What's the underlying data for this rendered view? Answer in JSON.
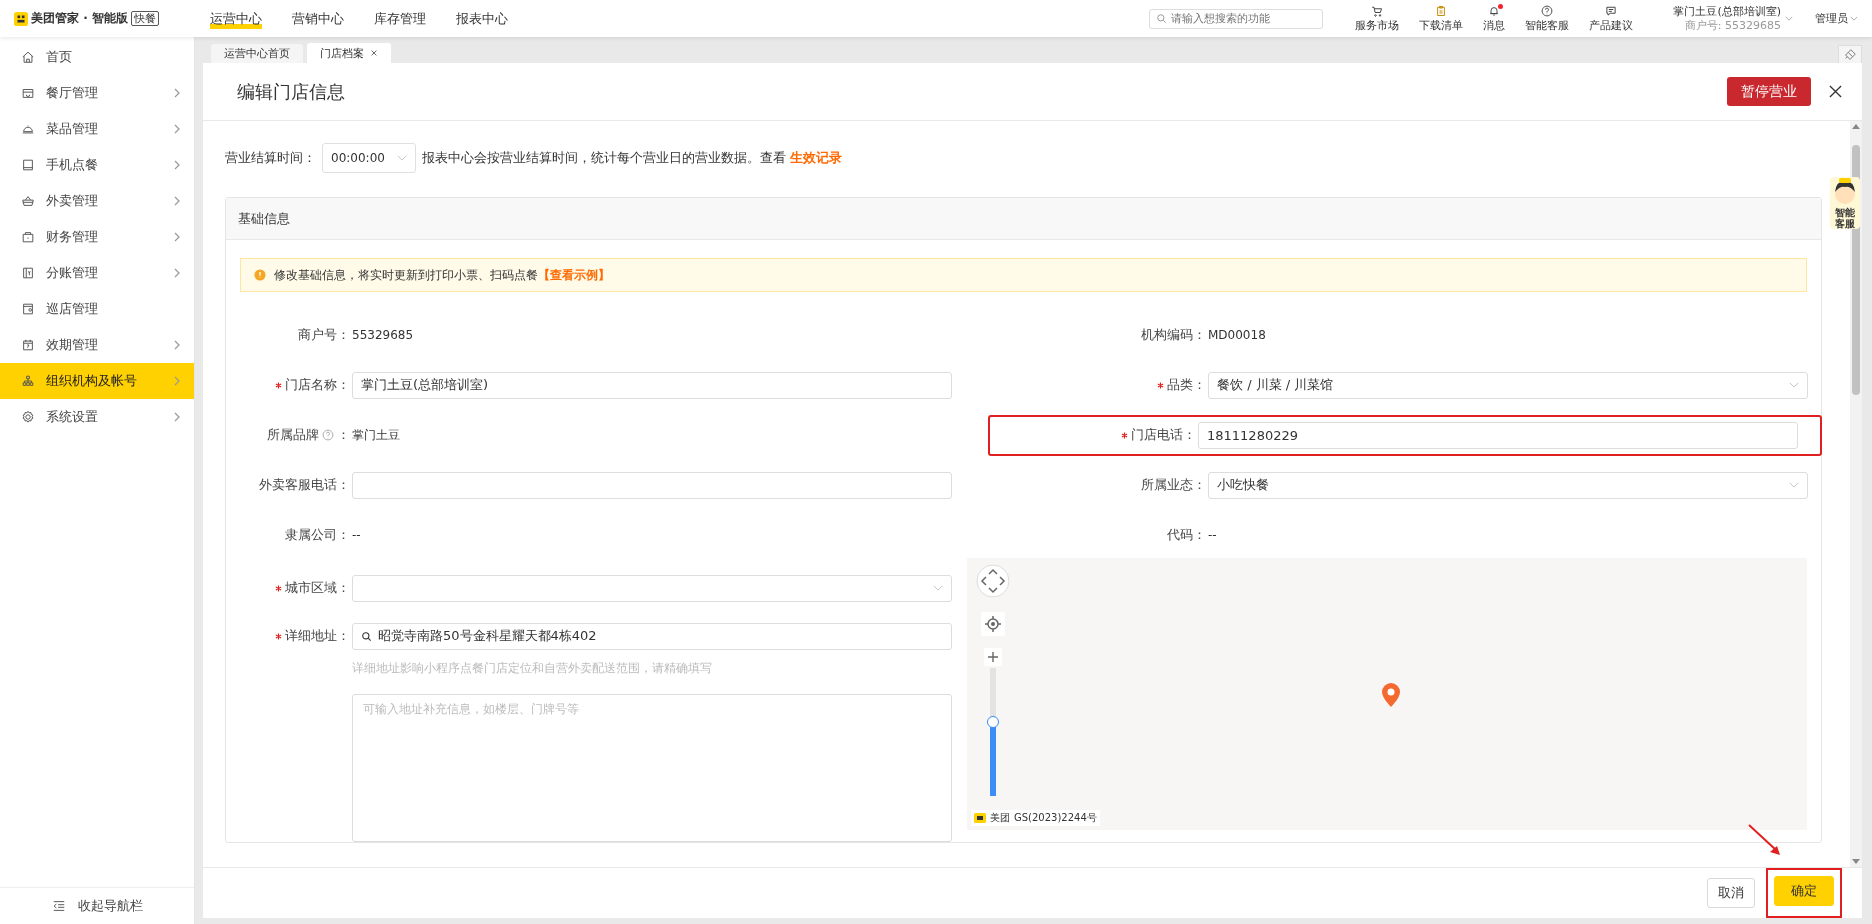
{
  "app": {
    "logo_text": "美团管家 · 智能版",
    "edition_badge": "快餐"
  },
  "top_nav": [
    {
      "label": "运营中心",
      "selected": true
    },
    {
      "label": "营销中心",
      "selected": false
    },
    {
      "label": "库存管理",
      "selected": false
    },
    {
      "label": "报表中心",
      "selected": false
    }
  ],
  "search": {
    "placeholder": "请输入想搜索的功能"
  },
  "toolbar": [
    {
      "label": "服务市场",
      "kind": "cart",
      "unread": false
    },
    {
      "label": "下载清单",
      "kind": "clipboard",
      "unread": false
    },
    {
      "label": "消息",
      "kind": "bell",
      "unread": true
    },
    {
      "label": "智能客服",
      "kind": "help",
      "unread": false
    },
    {
      "label": "产品建议",
      "kind": "chat",
      "unread": false
    }
  ],
  "account": {
    "store": "掌门土豆(总部培训室)",
    "merchant_id": "商户号: 55329685",
    "role": "管理员"
  },
  "sidebar": {
    "items": [
      {
        "label": "首页",
        "kind": "home",
        "has_submenu": false,
        "selected": false
      },
      {
        "label": "餐厅管理",
        "kind": "store",
        "has_submenu": true,
        "selected": false
      },
      {
        "label": "菜品管理",
        "kind": "cloche",
        "has_submenu": true,
        "selected": false
      },
      {
        "label": "手机点餐",
        "kind": "tablet",
        "has_submenu": true,
        "selected": false
      },
      {
        "label": "外卖管理",
        "kind": "basket",
        "has_submenu": true,
        "selected": false
      },
      {
        "label": "财务管理",
        "kind": "wallet",
        "has_submenu": true,
        "selected": false
      },
      {
        "label": "分账管理",
        "kind": "ledger",
        "has_submenu": true,
        "selected": false
      },
      {
        "label": "巡店管理",
        "kind": "patrol",
        "has_submenu": false,
        "selected": false
      },
      {
        "label": "效期管理",
        "kind": "calendar",
        "has_submenu": true,
        "selected": false
      },
      {
        "label": "组织机构及帐号",
        "kind": "org",
        "has_submenu": true,
        "selected": true
      },
      {
        "label": "系统设置",
        "kind": "gear",
        "has_submenu": true,
        "selected": false
      }
    ],
    "collapse_label": "收起导航栏"
  },
  "page_tabs": [
    {
      "label": "运营中心首页",
      "selected": false,
      "closable": false
    },
    {
      "label": "门店档案",
      "selected": true,
      "closable": true
    }
  ],
  "assistant_float": {
    "label": "智能客服"
  },
  "dialog": {
    "title": "编辑门店信息",
    "pause_button": "暂停营业",
    "settlement": {
      "label": "营业结算时间：",
      "value": "00:00:00",
      "note": "报表中心会按营业结算时间，统计每个营业日的营业数据。查看",
      "link": "生效记录"
    },
    "section_title": "基础信息",
    "alert": {
      "text": "修改基础信息，将实时更新到打印小票、扫码点餐",
      "link": "【查看示例】"
    },
    "fields": [
      {
        "kind": "text",
        "label": "商户号：",
        "value": "55329685",
        "required": false,
        "highlighted": false
      },
      {
        "kind": "text",
        "label": "机构编码：",
        "value": "MD00018",
        "required": false,
        "highlighted": false
      },
      {
        "kind": "input",
        "label": "门店名称：",
        "value": "掌门土豆(总部培训室)",
        "required": true,
        "highlighted": false
      },
      {
        "kind": "select",
        "label": "品类：",
        "value": "餐饮 / 川菜 / 川菜馆",
        "required": true,
        "highlighted": false
      },
      {
        "kind": "text",
        "label": "所属品牌",
        "help": true,
        "label_colon": "：",
        "value": "掌门土豆",
        "required": false,
        "highlighted": false
      },
      {
        "kind": "input",
        "label": "门店电话：",
        "value": "18111280229",
        "required": true,
        "highlighted": true
      },
      {
        "kind": "input",
        "label": "外卖客服电话：",
        "required": false,
        "highlighted": false
      },
      {
        "kind": "select",
        "label": "所属业态：",
        "value": "小吃快餐",
        "required": false,
        "highlighted": false
      },
      {
        "kind": "text",
        "label": "隶属公司：",
        "value": "--",
        "required": false,
        "highlighted": false
      },
      {
        "kind": "text",
        "label": "代码：",
        "value": "--",
        "required": false,
        "highlighted": false
      }
    ],
    "address": {
      "city_label": "城市区域：",
      "city_required": true,
      "detail_label": "详细地址：",
      "detail_required": true,
      "detail_value": "昭觉寺南路50号金科星耀天都4栋402",
      "hint": "详细地址影响小程序点餐门店定位和自营外卖配送范围，请精确填写",
      "extra_placeholder": "可输入地址补充信息，如楼层、门牌号等"
    },
    "map": {
      "zoom": {
        "level": 0.58
      },
      "brand": "美团",
      "attribution": "GS(2023)2244号"
    },
    "buttons": [
      {
        "label": "取消",
        "kind": "cancel",
        "highlighted": false
      },
      {
        "label": "确定",
        "kind": "confirm",
        "highlighted": true
      }
    ]
  }
}
